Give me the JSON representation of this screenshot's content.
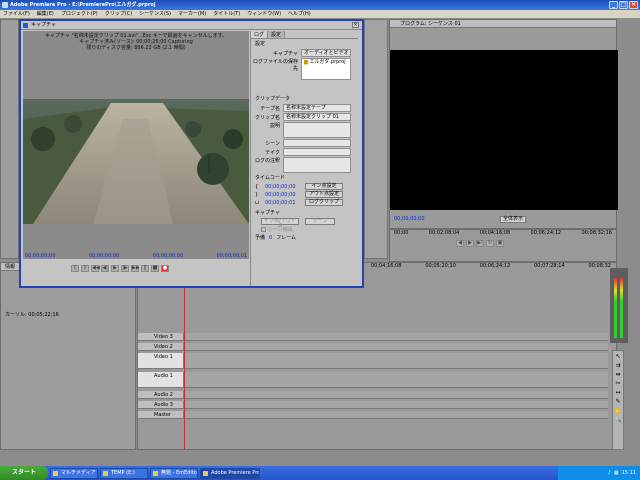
{
  "app": {
    "title": "Adobe Premiere Pro - E:\\PremierePro\\エルガダ.prproj"
  },
  "menu": [
    "ファイル(F)",
    "編集(E)",
    "プロジェクト(P)",
    "クリップ(C)",
    "シーケンス(S)",
    "マーカー(M)",
    "タイトル(T)",
    "ウィンドウ(W)",
    "ヘルプ(H)"
  ],
  "capture": {
    "title": "キャプチャ",
    "info_lines": [
      "キャプチャ \"名称未設定クリップ 01.avi\"...Esc キーで録画をキャンセルします。",
      "キャプチャ済み(ソース): 00;00;26;00 Capturing",
      "残りのディスク容量: 886.22 GB (2.1 時間)"
    ],
    "tabs": [
      "ログ",
      "設定"
    ],
    "settings_section": "設定",
    "capture_label": "キャプチャ",
    "capture_value": "オーディオとビデオ",
    "log_dest_label": "ログファイルの保存先",
    "log_dest_value": "エルガダ.prproj",
    "clipdata_section": "クリップデータ",
    "tape_label": "テープ名",
    "tape_value": "名称未設定テープ",
    "clip_label": "クリップ名",
    "clip_value": "名称未設定クリップ 01",
    "desc_label": "説明",
    "scene_label": "シーン",
    "take_label": "テイク",
    "log_note_label": "ログの注釈",
    "timecode_section": "タイムコード",
    "tc_in": "00;00;00;00",
    "tc_out": "00;00;00;00",
    "tc_dur": "00;00;00;01",
    "set_in": "イン点設定",
    "set_out": "アウト点設定",
    "log_clip": "ログクリップ",
    "capture_section": "キャプチャ",
    "btn_inout": "イン点/アウト点",
    "btn_tape": "テープ",
    "scene_detect": "シーン検出",
    "handles_label": "予備",
    "handles_value": "0",
    "frames_label": "フレーム",
    "tc_left": "00;00;00;00",
    "tc_mid": "00;00;00;00",
    "tc_right": "00;00;00;01",
    "tc_right2": "00;00;00;00"
  },
  "program": {
    "tab": "プログラム: シーケンス 01",
    "tc_current": "00;00;00;00",
    "zoom": "全体表示",
    "ruler": [
      "00;00",
      "00;02;08;04",
      "00;04;16;08",
      "00;06;24;12",
      "00;08;32;16"
    ]
  },
  "timeline": {
    "ruler": [
      "00;04;16;08",
      "00;05;20;10",
      "00;06;24;12",
      "00;07;28;14",
      "00;08;32"
    ],
    "tracks": [
      "Video 3",
      "Video 2",
      "Video 1",
      "Audio 1",
      "Audio 2",
      "Audio 3",
      "Master"
    ]
  },
  "left": {
    "bottom_label": "カーソル: 00;05;22;16",
    "tab": "情報"
  },
  "taskbar": {
    "start": "スタート",
    "items": [
      "マルチメディア",
      "TEMP (E:)",
      "無題 - EmEditor",
      "Adobe Premiere Pro..."
    ],
    "clock": "15:11"
  }
}
